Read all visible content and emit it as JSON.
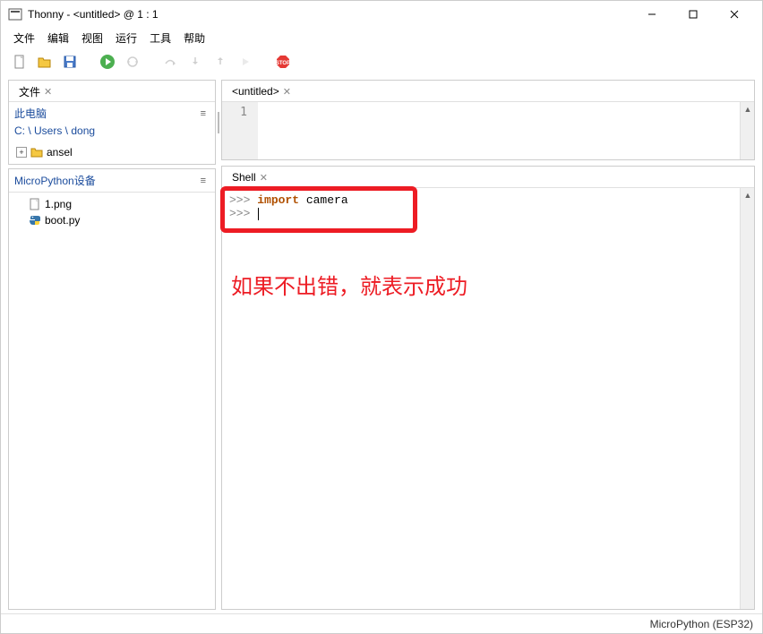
{
  "window": {
    "title": "Thonny  -  <untitled>  @  1 : 1"
  },
  "menu": {
    "file": "文件",
    "edit": "编辑",
    "view": "视图",
    "run": "运行",
    "tools": "工具",
    "help": "帮助"
  },
  "files_panel": {
    "tab_label": "文件",
    "computer_label": "此电脑",
    "path": "C: \\ Users \\ dong",
    "folder_name": "ansel"
  },
  "device_panel": {
    "header": "MicroPython设备",
    "files": [
      {
        "name": "1.png",
        "kind": "image"
      },
      {
        "name": "boot.py",
        "kind": "python"
      }
    ]
  },
  "editor": {
    "tab_label": "<untitled>",
    "line_number": "1"
  },
  "shell": {
    "tab_label": "Shell",
    "line1_prompt": ">>> ",
    "line1_kw": "import",
    "line1_rest": " camera",
    "line2_prompt": ">>> "
  },
  "annotation_text": "如果不出错，就表示成功",
  "status": {
    "backend": "MicroPython (ESP32)"
  }
}
